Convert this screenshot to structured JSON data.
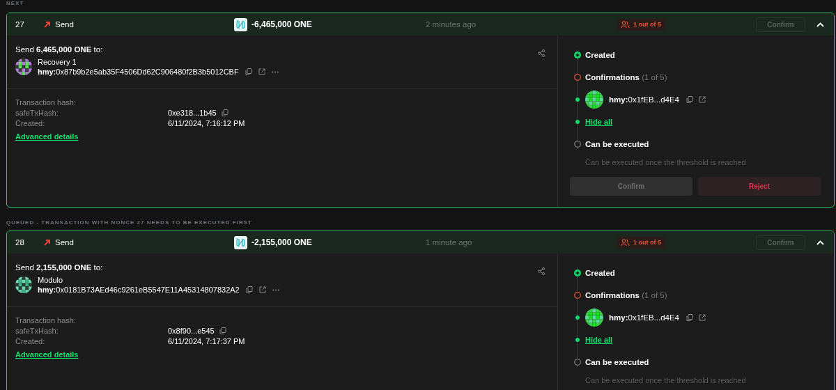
{
  "sections": [
    {
      "label": "NEXT",
      "transaction": {
        "nonce": "27",
        "type": "Send",
        "amount": "-6,465,000 ONE",
        "time": "2 minutes ago",
        "badge": "1 out of 5",
        "header_button": {
          "label": "Confirm",
          "disabled": true
        },
        "expanded": true,
        "summary": "Send **6,465,000 ONE** to:",
        "recipient": {
          "name": "Recovery 1",
          "address": "**hmy:**0x87b9b2e5ab35F4506Dd62C906480f2B3b5012CBF"
        },
        "details": [
          {
            "label": "Transaction hash:"
          },
          {
            "label": "safeTxHash:",
            "value": "0xe318...1b45",
            "copyable": true
          },
          {
            "label": "Created:",
            "value": "6/11/2024, 7:16:12 PM"
          }
        ],
        "advanced_link": "Advanced details",
        "timeline": [
          {
            "kind": "created",
            "label": "Created"
          },
          {
            "kind": "confirmations",
            "label": "Confirmations",
            "count": "(1 of 5)"
          },
          {
            "kind": "signer",
            "address": "**hmy:**0x1fEB...d4E4"
          },
          {
            "kind": "link",
            "label": "Hide all"
          },
          {
            "kind": "pending",
            "label": "Can be executed",
            "note": "Can be executed once the threshold is reached"
          }
        ],
        "actions": [
          {
            "kind": "confirm",
            "label": "Confirm",
            "disabled": true
          },
          {
            "kind": "reject",
            "label": "Reject",
            "disabled": false
          }
        ]
      }
    },
    {
      "label": "QUEUED - TRANSACTION WITH NONCE 27 NEEDS TO BE EXECUTED FIRST",
      "transaction": {
        "nonce": "28",
        "type": "Send",
        "amount": "-2,155,000 ONE",
        "time": "1 minute ago",
        "badge": "1 out of 5",
        "header_button": {
          "label": "Confirm",
          "disabled": true
        },
        "expanded": true,
        "summary": "Send **2,155,000 ONE** to:",
        "recipient": {
          "name": "Modulo",
          "address": "**hmy:**0x0181B73AEd46c9261eB5547E11A45314807832A2"
        },
        "details": [
          {
            "label": "Transaction hash:"
          },
          {
            "label": "safeTxHash:",
            "value": "0x8f90...e545",
            "copyable": true
          },
          {
            "label": "Created:",
            "value": "6/11/2024, 7:17:37 PM"
          }
        ],
        "advanced_link": "Advanced details",
        "timeline": [
          {
            "kind": "created",
            "label": "Created"
          },
          {
            "kind": "confirmations",
            "label": "Confirmations",
            "count": "(1 of 5)"
          },
          {
            "kind": "signer",
            "address": "**hmy:**0x1fEB...d4E4"
          },
          {
            "kind": "link",
            "label": "Hide all"
          },
          {
            "kind": "pending",
            "label": "Can be executed",
            "note": "Can be executed once the threshold is reached"
          }
        ]
      }
    }
  ]
}
